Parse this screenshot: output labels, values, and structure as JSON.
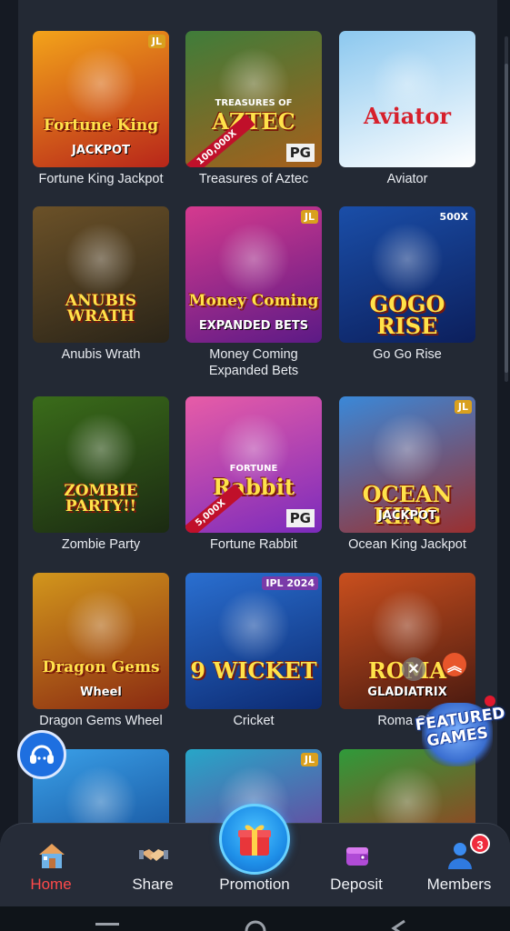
{
  "games": [
    {
      "label": "Fortune King Jackpot",
      "title": "Fortune King",
      "subtitle": "JACKPOT",
      "badge": "JL",
      "bg": [
        "#f3a31a",
        "#b8261a"
      ]
    },
    {
      "label": "Treasures of Aztec",
      "title": "AZTEC",
      "subtitle": "TREASURES OF",
      "corner": "100,000X",
      "provider": "PG",
      "bg": [
        "#3f7d3a",
        "#a65f1b"
      ]
    },
    {
      "label": "Aviator",
      "title": "Aviator",
      "bg": [
        "#8cc8ef",
        "#ffffff"
      ]
    },
    {
      "label": "Anubis Wrath",
      "title": "ANUBIS WRATH",
      "bg": [
        "#6b5128",
        "#2a2418"
      ]
    },
    {
      "label": "Money Coming Expanded Bets",
      "title": "Money Coming",
      "subtitle": "EXPANDED BETS",
      "badge": "JL",
      "bg": [
        "#d53a8e",
        "#5c1a86"
      ]
    },
    {
      "label": "Go Go Rise",
      "title": "GOGO RISE",
      "badge": "500X",
      "bg": [
        "#1a4ea8",
        "#0c1f5c"
      ]
    },
    {
      "label": "Zombie Party",
      "title": "ZOMBIE PARTY!!",
      "bg": [
        "#3a6c1a",
        "#1b2a12"
      ]
    },
    {
      "label": "Fortune Rabbit",
      "title": "Rabbit",
      "subtitle": "FORTUNE",
      "corner": "5,000X",
      "provider": "PG",
      "bg": [
        "#e75ca7",
        "#7b2bbc"
      ]
    },
    {
      "label": "Ocean King Jackpot",
      "title": "OCEAN KING",
      "subtitle": "JACKPOT",
      "badge": "JL",
      "bg": [
        "#3a88d8",
        "#9a2f2f"
      ]
    },
    {
      "label": "Dragon Gems Wheel",
      "title": "Dragon Gems",
      "subtitle": "Wheel",
      "bg": [
        "#d2961c",
        "#8a2a12"
      ]
    },
    {
      "label": "Cricket",
      "title": "9 WICKET",
      "badge": "IPL 2024",
      "bg": [
        "#2a6fd0",
        "#0c2a72"
      ]
    },
    {
      "label": "Roma Gla",
      "title": "ROMA",
      "subtitle": "GLADIATRIX",
      "bg": [
        "#c94f1e",
        "#4a1a10"
      ]
    },
    {
      "label": "",
      "title": "",
      "bg": [
        "#3aa0e8",
        "#0e3f8a"
      ]
    },
    {
      "label": "",
      "title": "",
      "badge": "JL",
      "bg": [
        "#27a6c8",
        "#7e2a92"
      ]
    },
    {
      "label": "",
      "title": "",
      "bg": [
        "#2f9a3a",
        "#b8261a"
      ]
    }
  ],
  "featured": {
    "label": "FEATURED GAMES"
  },
  "nav": [
    {
      "label": "Home",
      "icon": "home-icon",
      "active": true
    },
    {
      "label": "Share",
      "icon": "handshake-icon"
    },
    {
      "label": "Promotion",
      "icon": "gift-icon"
    },
    {
      "label": "Deposit",
      "icon": "wallet-icon"
    },
    {
      "label": "Members",
      "icon": "members-icon",
      "badge": "3"
    }
  ],
  "colors": {
    "accent": "#ff4a4a",
    "panel": "#232934",
    "promo": "#1e8fe8"
  }
}
